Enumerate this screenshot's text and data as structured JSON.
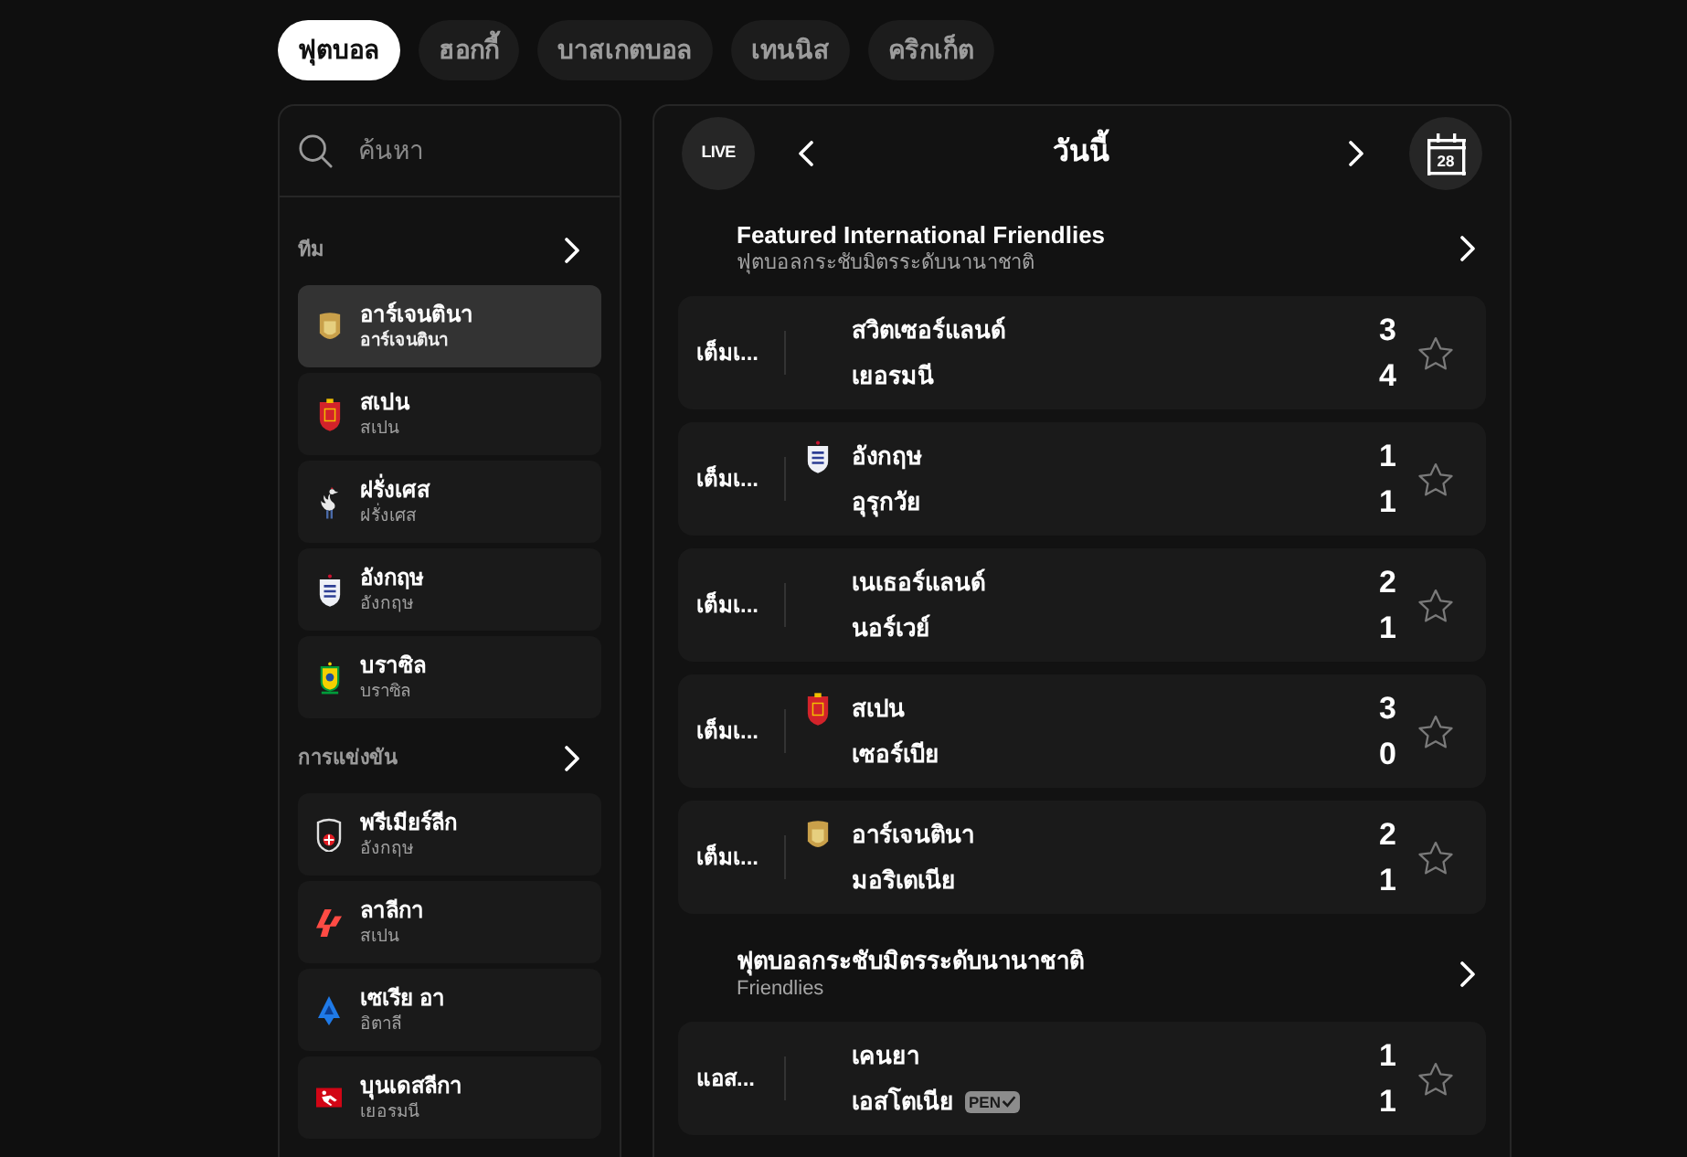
{
  "tabs": [
    {
      "label": "ฟุตบอล",
      "selected": true
    },
    {
      "label": "ฮอกกี้",
      "selected": false
    },
    {
      "label": "บาสเกตบอล",
      "selected": false
    },
    {
      "label": "เทนนิส",
      "selected": false
    },
    {
      "label": "คริกเก็ต",
      "selected": false
    }
  ],
  "sidebar": {
    "search": {
      "placeholder": "ค้นหา"
    },
    "sections": [
      {
        "title": "ทีม",
        "items": [
          {
            "name": "อาร์เจนตินา",
            "subtitle": "อาร์เจนตินา",
            "selected": true
          },
          {
            "name": "สเปน",
            "subtitle": "สเปน",
            "selected": false
          },
          {
            "name": "ฝรั่งเศส",
            "subtitle": "ฝรั่งเศส",
            "selected": false
          },
          {
            "name": "อังกฤษ",
            "subtitle": "อังกฤษ",
            "selected": false
          },
          {
            "name": "บราซิล",
            "subtitle": "บราซิล",
            "selected": false
          }
        ]
      },
      {
        "title": "การแข่งขัน",
        "items": [
          {
            "name": "พรีเมียร์ลีก",
            "subtitle": "อังกฤษ",
            "selected": false
          },
          {
            "name": "ลาลีกา",
            "subtitle": "สเปน",
            "selected": false
          },
          {
            "name": "เซเรีย อา",
            "subtitle": "อิตาลี",
            "selected": false
          },
          {
            "name": "บุนเดสลีกา",
            "subtitle": "เยอรมนี",
            "selected": false
          }
        ]
      }
    ]
  },
  "schedule": {
    "live_label": "LIVE",
    "title": "วันนี้",
    "calendar_day": "28",
    "leagues": [
      {
        "title": "Featured International Friendlies",
        "subtitle": "ฟุตบอลกระชับมิตรระดับนานาชาติ",
        "matches": [
          {
            "status": "เต็มเ...",
            "favorite": false,
            "teams": [
              {
                "name": "สวิตเซอร์แลนด์",
                "score": "3"
              },
              {
                "name": "เยอรมนี",
                "score": "4"
              }
            ]
          },
          {
            "status": "เต็มเ...",
            "favorite": false,
            "teams": [
              {
                "name": "อังกฤษ",
                "score": "1"
              },
              {
                "name": "อุรุกวัย",
                "score": "1"
              }
            ]
          },
          {
            "status": "เต็มเ...",
            "favorite": false,
            "teams": [
              {
                "name": "เนเธอร์แลนด์",
                "score": "2"
              },
              {
                "name": "นอร์เวย์",
                "score": "1"
              }
            ]
          },
          {
            "status": "เต็มเ...",
            "favorite": false,
            "teams": [
              {
                "name": "สเปน",
                "score": "3"
              },
              {
                "name": "เซอร์เบีย",
                "score": "0"
              }
            ]
          },
          {
            "status": "เต็มเ...",
            "favorite": false,
            "teams": [
              {
                "name": "อาร์เจนตินา",
                "score": "2"
              },
              {
                "name": "มอริเตเนีย",
                "score": "1"
              }
            ]
          }
        ]
      },
      {
        "title": "ฟุตบอลกระชับมิตรระดับนานาชาติ",
        "subtitle": "Friendlies",
        "matches": [
          {
            "status": "แอส...",
            "favorite": false,
            "teams": [
              {
                "name": "เคนยา",
                "score": "1"
              },
              {
                "name": "เอสโตเนีย",
                "score": "1",
                "badge": "PEN"
              }
            ]
          }
        ]
      }
    ]
  }
}
